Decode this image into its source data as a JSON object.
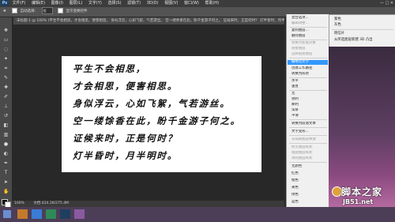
{
  "menubar": {
    "app_icon": "Ps",
    "items": [
      "文件(F)",
      "编辑(E)",
      "图像(I)",
      "图层(L)",
      "文字(Y)",
      "选择(S)",
      "滤镜(T)",
      "3D(D)",
      "视图(V)",
      "窗口(W)",
      "帮助(H)"
    ],
    "window_controls": "— □ ✕"
  },
  "options": {
    "mode_label": "自动选择：",
    "mode_value": "组",
    "transform_label": "显示变换控件"
  },
  "tab": {
    "title": "未标题-1 @ 100% (平生不会相思，才会相思，便害相思。 身似浮云，心如飞絮，气若游丝。 空一缕余香在此，盼千金游子何之。 证候来时，正是何时？ 灯半昏时，月半明时。, RGB/8) *"
  },
  "poem": {
    "lines": [
      "平生不会相思，",
      "才会相思，便害相思。",
      "身似浮云，心如飞絮，气若游丝。",
      "空一缕馀香在此，盼千金游子何之。",
      "证候来时，正是何时？",
      "灯半昏时，月半明时。"
    ]
  },
  "status": {
    "zoom": "100%",
    "doc": "文档:424.2K/275.4M"
  },
  "context_menu": {
    "items": [
      {
        "label": "混合选项...",
        "state": "normal"
      },
      {
        "label": "编辑调整...",
        "state": "disabled"
      },
      {
        "label": "复制图层...",
        "state": "normal"
      },
      {
        "label": "删除图层",
        "state": "normal"
      },
      {
        "label": "转换为智能对象",
        "state": "disabled"
      },
      {
        "label": "链接图层",
        "state": "disabled"
      },
      {
        "label": "选择链接图层",
        "state": "disabled"
      },
      {
        "label": "栅格化文字",
        "state": "highlighted"
      },
      {
        "label": "创建工作路径",
        "state": "normal"
      },
      {
        "label": "转换为形状",
        "state": "normal"
      },
      {
        "label": "水平",
        "state": "normal"
      },
      {
        "label": "垂直",
        "state": "normal"
      },
      {
        "label": "无",
        "state": "normal"
      },
      {
        "label": "锐利",
        "state": "normal"
      },
      {
        "label": "犀利",
        "state": "normal"
      },
      {
        "label": "浑厚",
        "state": "normal"
      },
      {
        "label": "平滑",
        "state": "normal"
      },
      {
        "label": "转换为段落文本",
        "state": "normal"
      },
      {
        "label": "文字变形...",
        "state": "normal"
      },
      {
        "label": "从隔离图层释放",
        "state": "disabled"
      },
      {
        "label": "拷贝图层样式",
        "state": "disabled"
      },
      {
        "label": "粘贴图层样式",
        "state": "disabled"
      },
      {
        "label": "清除图层样式",
        "state": "disabled"
      },
      {
        "label": "无颜色",
        "state": "normal"
      },
      {
        "label": "红色",
        "state": "normal"
      },
      {
        "label": "橙色",
        "state": "normal"
      },
      {
        "label": "黄色",
        "state": "normal"
      },
      {
        "label": "绿色",
        "state": "normal"
      },
      {
        "label": "蓝色",
        "state": "normal"
      },
      {
        "label": "紫色",
        "state": "normal"
      },
      {
        "label": "灰色",
        "state": "normal"
      }
    ]
  },
  "submenu": {
    "items": [
      "紫色",
      "灰色",
      "明信片",
      "从所选图层新建 3D 凸出"
    ]
  },
  "watermark": {
    "line1": "脚本之家",
    "line2": "JB51.net"
  },
  "colors": {
    "highlight": "#3399ff",
    "canvas_bg": "#282828",
    "taskbar": "#4d3e58"
  }
}
